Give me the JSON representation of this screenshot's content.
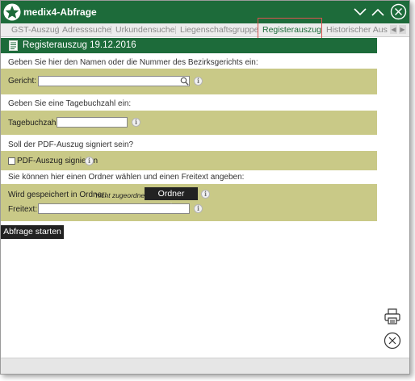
{
  "window": {
    "title": "medix4-Abfrage"
  },
  "tabs": [
    {
      "label": "GST-Auszug"
    },
    {
      "label": "Adresssuche"
    },
    {
      "label": "Urkundensuche"
    },
    {
      "label": "Liegenschaftsgruppe"
    },
    {
      "label": "Registerauszug"
    },
    {
      "label": "Historischer Ausz"
    }
  ],
  "section": {
    "title": "Registerauszug 19.12.2016"
  },
  "gericht": {
    "prompt": "Geben Sie hier den Namen oder die Nummer des Bezirksgerichts ein:",
    "label": "Gericht:",
    "value": ""
  },
  "tagebuch": {
    "prompt": "Geben Sie eine Tagebuchzahl ein:",
    "label": "Tagebuchzahl:",
    "value": ""
  },
  "pdf": {
    "prompt": "Soll der PDF-Auszug signiert sein?",
    "checkbox_label": "PDF-Auszug signieren",
    "checked": false
  },
  "ordner": {
    "prompt": "Sie können hier einen Ordner wählen und einen Freitext angeben:",
    "label": "Wird gespeichert in Ordner:",
    "value": "'nicht zugeordnet'",
    "button_label": "Ordner ändern",
    "freitext_label": "Freitext:",
    "freitext_value": ""
  },
  "actions": {
    "start_label": "Abfrage starten"
  },
  "colors": {
    "titlebar": "#1d6b3a",
    "panel": "#c9c987",
    "highlight": "#d9534f"
  }
}
